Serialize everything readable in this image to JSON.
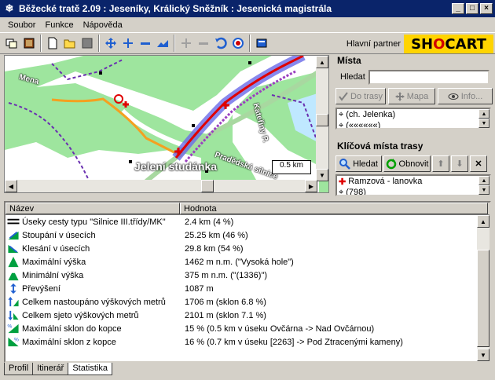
{
  "window": {
    "title": "Běžecké tratě 2.09 : Jeseníky, Králický Sněžník : Jesenická magistrála"
  },
  "menu": {
    "items": [
      "Soubor",
      "Funkce",
      "Nápověda"
    ]
  },
  "toolbar": {
    "partner_label": "Hlavní partner",
    "logo_text": "SHOCART"
  },
  "map": {
    "place_label": "Jelení studánka",
    "place_label_top": "Mena",
    "road_label": "Kateřiny P.",
    "road_label2": "Pradědská silnice",
    "scale": "0.5 km"
  },
  "places": {
    "heading": "Místa",
    "search_label": "Hledat",
    "search_value": "",
    "buttons": [
      "Do trasy",
      "Mapa",
      "Info..."
    ],
    "list": [
      "(ch. Jelenka)",
      "(««««««)"
    ]
  },
  "keypoints": {
    "heading": "Klíčová místa trasy",
    "search_button": "Hledat",
    "refresh_button": "Obnovit",
    "list": [
      "Ramzová - lanovka",
      "(798)"
    ]
  },
  "table": {
    "columns": [
      "Název",
      "Hodnota"
    ],
    "rows": [
      {
        "icon": "road-icon",
        "name": "Úseky cesty typu \"Silnice III.třídy/MK\"",
        "value": "2.4 km (4 %)"
      },
      {
        "icon": "ascent-icon",
        "name": "Stoupání v úsecích",
        "value": "25.25 km (46 %)"
      },
      {
        "icon": "descent-icon",
        "name": "Klesání v úsecích",
        "value": "29.8 km (54 %)"
      },
      {
        "icon": "max-height-icon",
        "name": "Maximální výška",
        "value": "1462 m n.m. (\"Vysoká hole\")"
      },
      {
        "icon": "min-height-icon",
        "name": "Minimální výška",
        "value": "375 m n.m. (\"(1336)\")"
      },
      {
        "icon": "elevation-diff-icon",
        "name": "Převýšení",
        "value": "1087 m"
      },
      {
        "icon": "total-ascent-icon",
        "name": "Celkem nastoupáno výškových metrů",
        "value": "1706 m (sklon 6.8 %)"
      },
      {
        "icon": "total-descent-icon",
        "name": "Celkem sjeto výškových metrů",
        "value": "2101 m (sklon 7.1 %)"
      },
      {
        "icon": "max-downhill-icon",
        "name": "Maximální sklon do kopce",
        "value": "15 % (0.5 km v úseku Ovčárna -> Nad Ovčárnou)"
      },
      {
        "icon": "max-uphill-icon",
        "name": "Maximální sklon z kopce",
        "value": "16 % (0.7 km v úseku [2263] -> Pod Ztracenými kameny)"
      }
    ]
  },
  "tabs": [
    "Profil",
    "Itinerář",
    "Statistika"
  ]
}
